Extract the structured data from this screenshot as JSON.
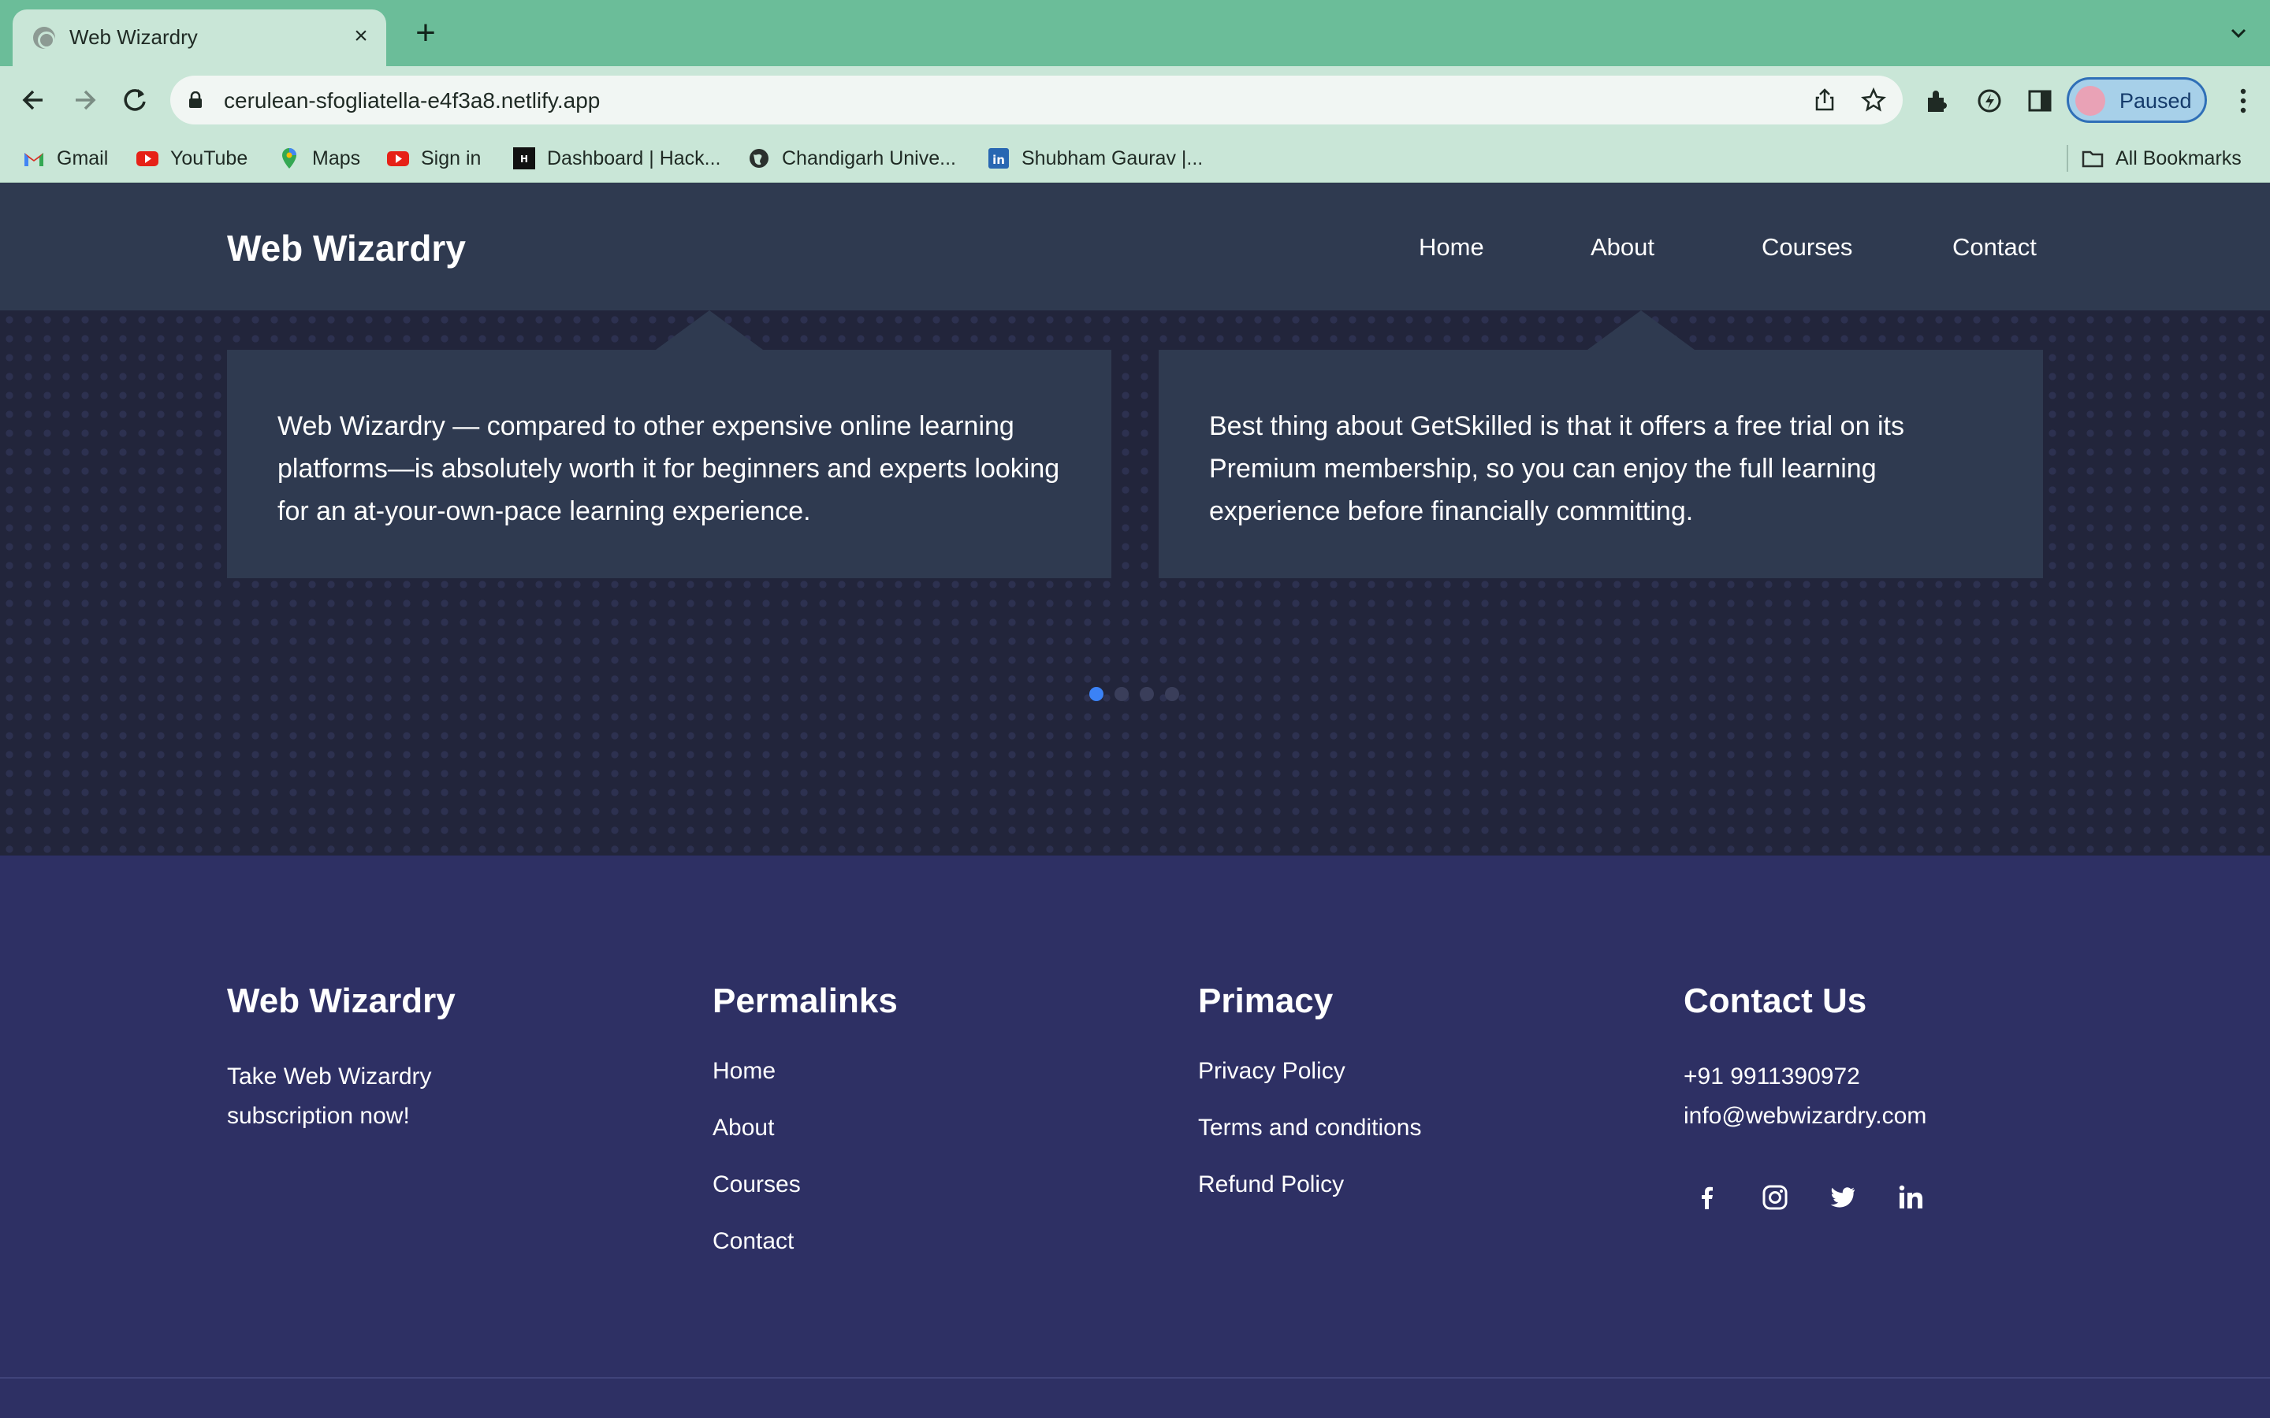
{
  "browser": {
    "tab_title": "Web Wizardry",
    "url": "cerulean-sfogliatella-e4f3a8.netlify.app",
    "profile_label": "Paused",
    "bookmarks": [
      {
        "label": "Gmail",
        "icon": "gmail-icon"
      },
      {
        "label": "YouTube",
        "icon": "youtube-icon"
      },
      {
        "label": "Maps",
        "icon": "maps-icon"
      },
      {
        "label": "Sign in",
        "icon": "youtube-icon"
      },
      {
        "label": "Dashboard | Hack...",
        "icon": "hackerrank-icon"
      },
      {
        "label": "Chandigarh Unive...",
        "icon": "globe-icon"
      },
      {
        "label": "Shubham Gaurav |...",
        "icon": "linkedin-icon"
      }
    ],
    "all_bookmarks": "All Bookmarks"
  },
  "header": {
    "brand": "Web Wizardry",
    "nav": [
      "Home",
      "About",
      "Courses",
      "Contact"
    ]
  },
  "testimonials": [
    {
      "text": "Web Wizardry — compared to other expensive online learning platforms—is absolutely worth it for beginners and experts looking for an at-your-own-pace learning experience."
    },
    {
      "text": "Best thing about GetSkilled is that it offers a free trial on its Premium membership, so you can enjoy the full learning experience before financially committing."
    }
  ],
  "carousel": {
    "count": 4,
    "active_index": 0
  },
  "footer": {
    "brand": {
      "title": "Web Wizardry",
      "tagline": "Take Web Wizardry subscription now!"
    },
    "permalinks": {
      "title": "Permalinks",
      "links": [
        "Home",
        "About",
        "Courses",
        "Contact"
      ]
    },
    "primacy": {
      "title": "Primacy",
      "links": [
        "Privacy Policy",
        "Terms and conditions",
        "Refund Policy"
      ]
    },
    "contact": {
      "title": "Contact Us",
      "phone": "+91 9911390972",
      "email": "info@webwizardry.com",
      "social": [
        "facebook-icon",
        "instagram-icon",
        "twitter-icon",
        "linkedin-icon"
      ]
    }
  },
  "colors": {
    "browser_frame": "#6bbd99",
    "browser_toolbar": "#c9e6d7",
    "header_bg": "#2f3a50",
    "testimonial_bg": "#22253b",
    "footer_bg": "#2e3064",
    "accent": "#3b82f6"
  }
}
